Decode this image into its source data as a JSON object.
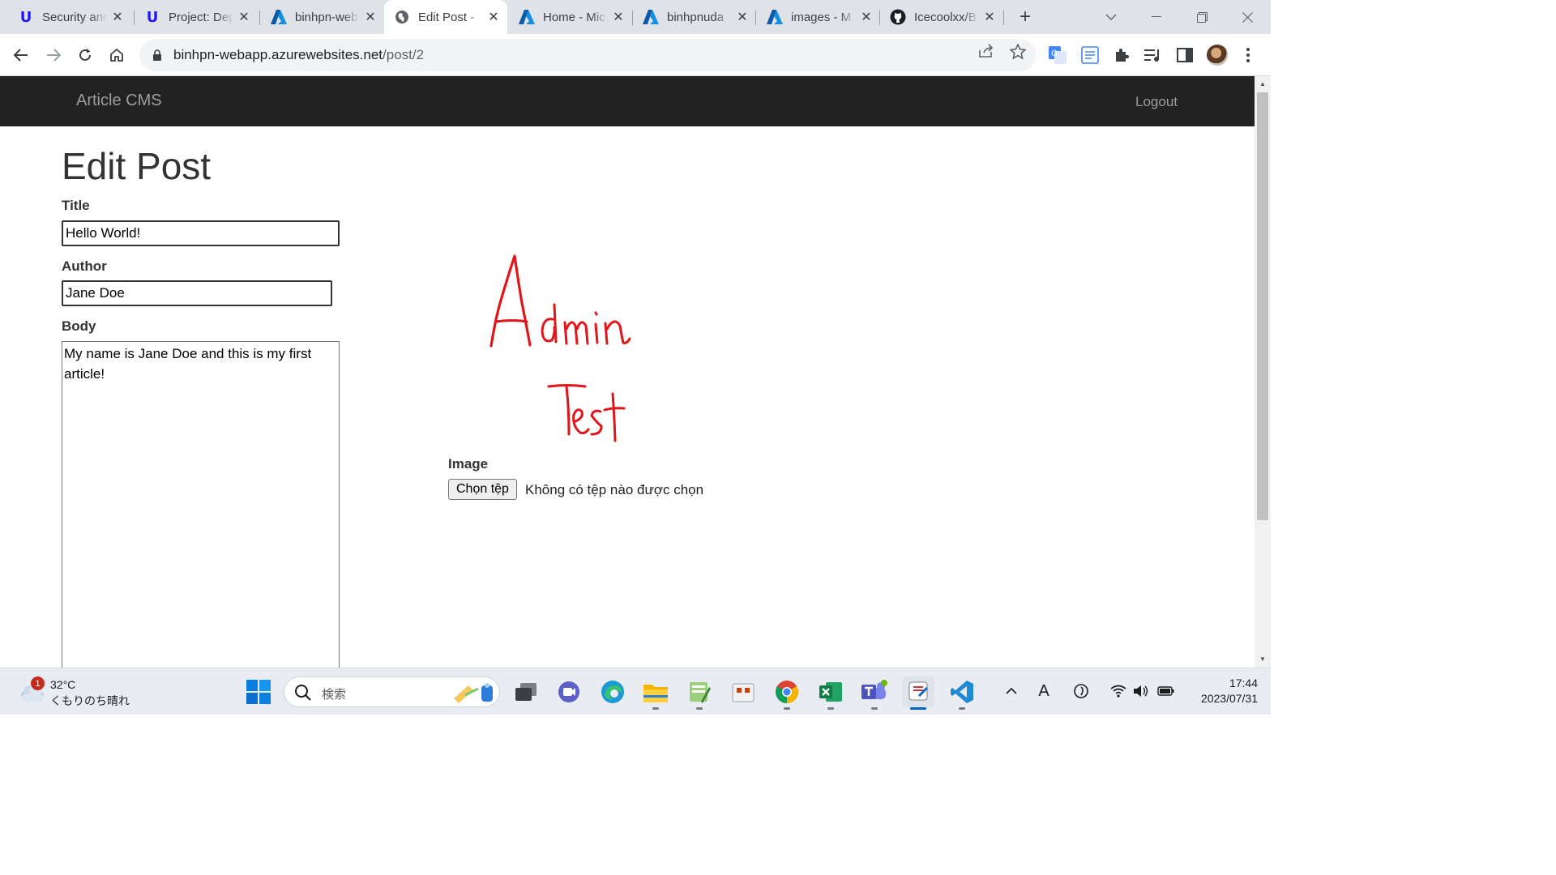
{
  "browser": {
    "tabs": [
      {
        "title": "Security and",
        "icon": "udacity-icon"
      },
      {
        "title": "Project: Dep",
        "icon": "udacity-icon"
      },
      {
        "title": "binhpn-web",
        "icon": "azure-icon"
      },
      {
        "title": "Edit Post - ",
        "icon": "globe-icon",
        "active": true
      },
      {
        "title": "Home - Mic",
        "icon": "azure-icon"
      },
      {
        "title": "binhpnuda",
        "icon": "azure-icon"
      },
      {
        "title": "images - M",
        "icon": "azure-icon"
      },
      {
        "title": "Icecoolxx/B",
        "icon": "github-icon"
      }
    ],
    "url_host": "binhpn-webapp.azurewebsites.net",
    "url_path": "/post/2"
  },
  "navbar": {
    "brand": "Article CMS",
    "logout_label": "Logout"
  },
  "form": {
    "heading": "Edit Post",
    "title_label": "Title",
    "title_value": "Hello World!",
    "author_label": "Author",
    "author_value": "Jane Doe",
    "body_label": "Body",
    "body_value": "My name is Jane Doe and this is my first article!",
    "image_label": "Image",
    "image_text": [
      "Admin",
      "Test"
    ],
    "image_color": "#e0161b",
    "file_button_label": "Chọn tệp",
    "file_status": "Không có tệp nào được chọn"
  },
  "taskbar": {
    "weather_badge": "1",
    "weather_temp": "32°C",
    "weather_desc": "くもりのち晴れ",
    "search_placeholder": "検索",
    "time": "17:44",
    "date": "2023/07/31",
    "ime_mode": "A"
  },
  "colors": {
    "navbar_bg": "#222222",
    "navbar_text": "#9d9d9d",
    "taskbar_accent": "#0067c0"
  }
}
